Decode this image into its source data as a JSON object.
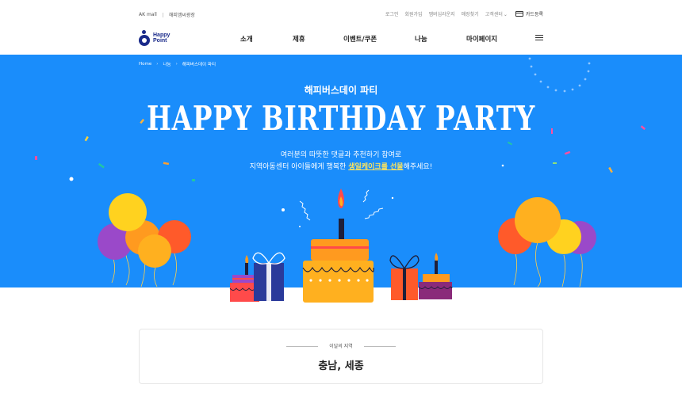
{
  "util": {
    "left_links": [
      "AK mall",
      "해피앰씨광장"
    ],
    "right_links": [
      "로그인",
      "회원가입",
      "멤버십라운지",
      "매장찾기",
      "고객센터"
    ],
    "card_register": "카드등록"
  },
  "gnb": {
    "logo_line1": "Happy",
    "logo_line2": "Point",
    "menu": [
      "소개",
      "제휴",
      "이벤트/쿠폰",
      "나눔",
      "마이페이지"
    ]
  },
  "hero": {
    "breadcrumb": [
      "Home",
      "나눔",
      "해피버스데이 파티"
    ],
    "subtitle": "해피버스데이 파티",
    "title": "HAPPY BIRTHDAY PARTY",
    "desc_line1": "여러분의 따뜻한 댓글과 추천하기 참여로",
    "desc_line2_pre": "지역아동센터 아이들에게 행복한 ",
    "desc_line2_highlight": "생일케이크를 선물",
    "desc_line2_post": "해주세요!",
    "bg_color": "#1a8dfb"
  },
  "region": {
    "label": "이달의 지역",
    "name": "충남, 세종"
  }
}
